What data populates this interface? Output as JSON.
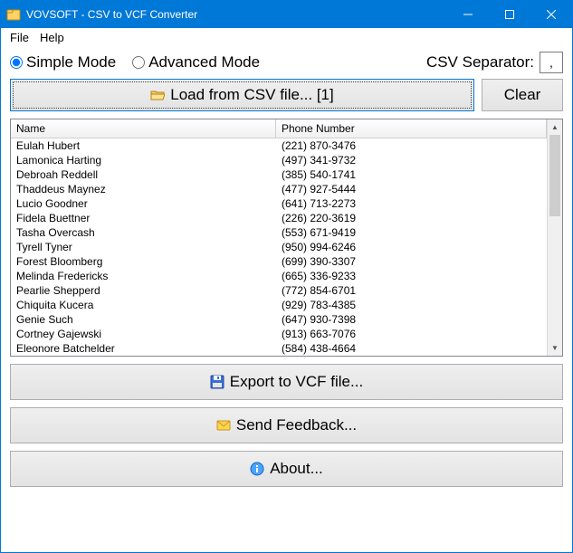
{
  "title": "VOVSOFT - CSV to VCF Converter",
  "menu": {
    "file": "File",
    "help": "Help"
  },
  "modes": {
    "simple": "Simple Mode",
    "advanced": "Advanced Mode"
  },
  "csv_sep_label": "CSV Separator:",
  "csv_sep_value": ",",
  "buttons": {
    "load": "Load from CSV file... [1]",
    "clear": "Clear",
    "export": "Export to VCF file...",
    "feedback": "Send Feedback...",
    "about": "About..."
  },
  "columns": {
    "name": "Name",
    "phone": "Phone Number"
  },
  "rows": [
    {
      "name": "Eulah Hubert",
      "phone": "(221) 870-3476"
    },
    {
      "name": "Lamonica Harting",
      "phone": "(497) 341-9732"
    },
    {
      "name": "Debroah Reddell",
      "phone": "(385) 540-1741"
    },
    {
      "name": "Thaddeus Maynez",
      "phone": "(477) 927-5444"
    },
    {
      "name": "Lucio Goodner",
      "phone": "(641) 713-2273"
    },
    {
      "name": "Fidela Buettner",
      "phone": "(226) 220-3619"
    },
    {
      "name": "Tasha Overcash",
      "phone": "(553) 671-9419"
    },
    {
      "name": "Tyrell Tyner",
      "phone": "(950) 994-6246"
    },
    {
      "name": "Forest Bloomberg",
      "phone": "(699) 390-3307"
    },
    {
      "name": "Melinda Fredericks",
      "phone": "(665) 336-9233"
    },
    {
      "name": "Pearlie Shepperd",
      "phone": "(772) 854-6701"
    },
    {
      "name": "Chiquita Kucera",
      "phone": "(929) 783-4385"
    },
    {
      "name": "Genie Such",
      "phone": "(647) 930-7398"
    },
    {
      "name": "Cortney Gajewski",
      "phone": "(913) 663-7076"
    },
    {
      "name": "Eleonore Batchelder",
      "phone": "(584) 438-4664"
    }
  ]
}
